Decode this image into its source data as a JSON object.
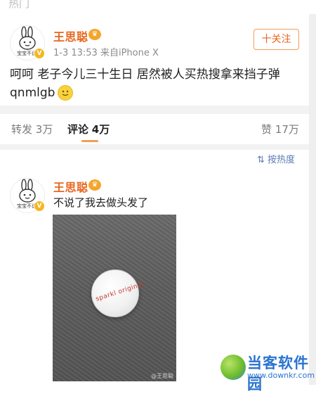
{
  "top": {
    "cut_text": "热门"
  },
  "post": {
    "author": "王思聪",
    "meta": "1-3 13:53  来自iPhone X",
    "follow_label": "十关注",
    "text_line1": "呵呵 老子今儿三十生日 居然被人买热搜拿来挡子弹",
    "text_line2": "qnmlgb",
    "avatar_caption": "宝宝不说"
  },
  "tabs": {
    "repost": {
      "label": "转发",
      "count": "3万"
    },
    "comment": {
      "label": "评论",
      "count": "4万"
    },
    "like": {
      "label": "赞",
      "count": "17万"
    }
  },
  "sort": {
    "label": "按热度"
  },
  "comment": {
    "author": "王思聪",
    "text": "不说了我去做头发了",
    "avatar_caption": "宝宝不说",
    "photo_disc_text": "sparkl original",
    "photo_watermark": "@王思聪"
  },
  "watermark": {
    "brand": "当客软件园",
    "url": "www.downkr.com"
  },
  "colors": {
    "accent": "#e8661e",
    "link": "#5b7bb5",
    "brand_blue": "#2a73cf"
  }
}
